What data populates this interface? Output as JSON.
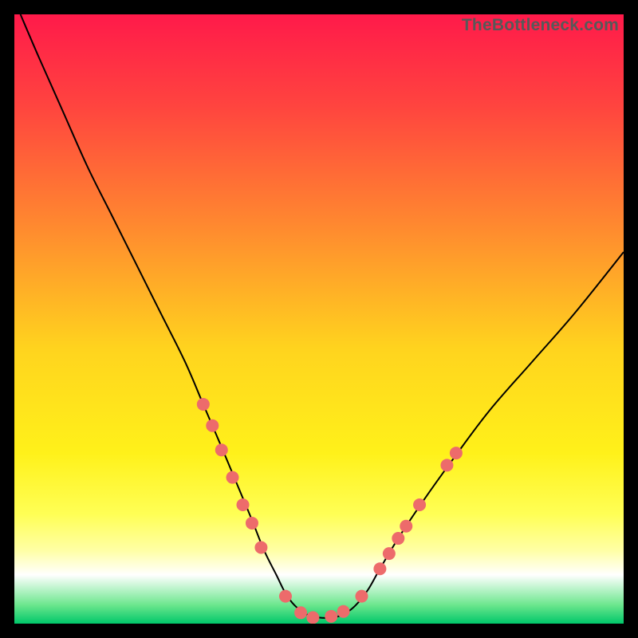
{
  "watermark": "TheBottleneck.com",
  "chart_data": {
    "type": "line",
    "title": "",
    "xlabel": "",
    "ylabel": "",
    "xlim": [
      0,
      100
    ],
    "ylim": [
      0,
      100
    ],
    "legend": false,
    "grid": false,
    "background": {
      "type": "vertical-gradient",
      "stops": [
        {
          "pos": 0.0,
          "color": "#ff1a4a"
        },
        {
          "pos": 0.15,
          "color": "#ff443f"
        },
        {
          "pos": 0.35,
          "color": "#ff8a2f"
        },
        {
          "pos": 0.55,
          "color": "#ffd41e"
        },
        {
          "pos": 0.72,
          "color": "#fff11a"
        },
        {
          "pos": 0.82,
          "color": "#ffff55"
        },
        {
          "pos": 0.88,
          "color": "#ffffa5"
        },
        {
          "pos": 0.92,
          "color": "#ffffff"
        },
        {
          "pos": 0.97,
          "color": "#6ae68c"
        },
        {
          "pos": 1.0,
          "color": "#00c76a"
        }
      ]
    },
    "series": [
      {
        "name": "bottleneck-curve",
        "color": "#000000",
        "stroke_width": 2,
        "x": [
          1,
          4,
          8,
          12,
          16,
          20,
          24,
          28,
          31,
          34,
          36.5,
          39,
          41,
          43,
          44.5,
          46,
          48,
          50,
          52,
          54,
          56,
          58,
          60,
          63,
          67,
          72,
          78,
          85,
          92,
          100
        ],
        "y": [
          100,
          93,
          84,
          75,
          67,
          59,
          51,
          43,
          36,
          29,
          23,
          17,
          12,
          8,
          5,
          3,
          1.5,
          1,
          1,
          1.5,
          3,
          5.5,
          9,
          14,
          20,
          27,
          35,
          43,
          51,
          61
        ]
      }
    ],
    "markers": {
      "name": "highlight-beads",
      "color": "#ed6b6b",
      "radius": 8,
      "points": [
        {
          "x": 31.0,
          "y": 36.0
        },
        {
          "x": 32.5,
          "y": 32.5
        },
        {
          "x": 34.0,
          "y": 28.5
        },
        {
          "x": 35.8,
          "y": 24.0
        },
        {
          "x": 37.5,
          "y": 19.5
        },
        {
          "x": 39.0,
          "y": 16.5
        },
        {
          "x": 40.5,
          "y": 12.5
        },
        {
          "x": 44.5,
          "y": 4.5
        },
        {
          "x": 47.0,
          "y": 1.8
        },
        {
          "x": 49.0,
          "y": 1.0
        },
        {
          "x": 52.0,
          "y": 1.2
        },
        {
          "x": 54.0,
          "y": 2.0
        },
        {
          "x": 57.0,
          "y": 4.5
        },
        {
          "x": 60.0,
          "y": 9.0
        },
        {
          "x": 61.5,
          "y": 11.5
        },
        {
          "x": 63.0,
          "y": 14.0
        },
        {
          "x": 64.3,
          "y": 16.0
        },
        {
          "x": 66.5,
          "y": 19.5
        },
        {
          "x": 71.0,
          "y": 26.0
        },
        {
          "x": 72.5,
          "y": 28.0
        }
      ]
    }
  }
}
